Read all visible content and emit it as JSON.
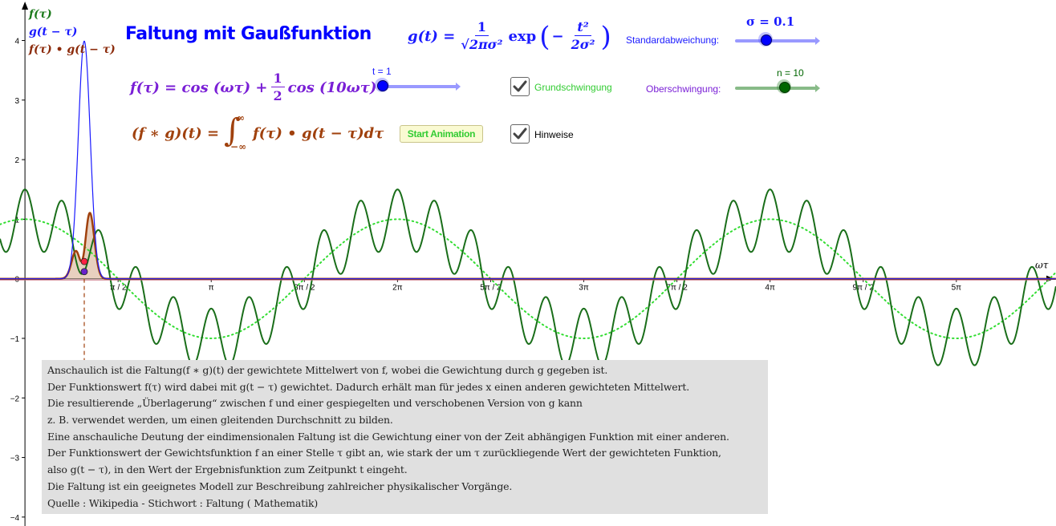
{
  "title": "Faltung mit Gaußfunktion",
  "legend": [
    {
      "label": "f(τ)",
      "color": "#1a7a1a"
    },
    {
      "label": "g(t − τ)",
      "color": "#1a1aff"
    },
    {
      "label": "f(τ) • g(t − τ)",
      "color": "#8b2a0a"
    }
  ],
  "formulas": {
    "g": {
      "lhs": "g(t) =",
      "frac_num": "1",
      "frac_den": "√2πσ²",
      "exp": "exp",
      "inner_sign": "−",
      "inner_num": "t²",
      "inner_den": "2σ²"
    },
    "f": {
      "lhs": "f(τ) = cos (ωτ) +",
      "frac_num": "1",
      "frac_den": "2",
      "rhs": "cos (10ωτ)"
    },
    "conv": {
      "lhs": "(f ∗ g)(t) =",
      "integral": "∫",
      "upper": "∞",
      "lower": "−∞",
      "rhs": "f(τ) • g(t − τ)dτ"
    }
  },
  "controls": {
    "sigma_slider": {
      "caption": "σ = 0.1",
      "label": "Standardabweichung:",
      "value": 0.1,
      "position_fraction": 0.37,
      "color": "#0000ff",
      "track_color": "#9999ff"
    },
    "t_slider": {
      "caption": "t = 1",
      "value": 1,
      "position_fraction": 0.0,
      "color": "#0000ff",
      "track_color": "#9999ff"
    },
    "n_slider": {
      "caption": "n = 10",
      "label": "Oberschwingung:",
      "value": 10,
      "position_fraction": 0.6,
      "color": "#006600",
      "track_color": "#88bb88"
    },
    "grundschwingung": {
      "label": "Grundschwingung",
      "checked": true,
      "color": "#33cc33"
    },
    "hinweise": {
      "label": "Hinweise",
      "checked": true,
      "color": "#000000"
    },
    "start_button": {
      "label": "Start Animation"
    }
  },
  "notes": [
    "Anschaulich ist die Faltung(f ∗ g)(t) der gewichtete Mittelwert von f, wobei die Gewichtung durch g gegeben ist.",
    "Der Funktionswert f(τ) wird dabei mit g(t − τ) gewichtet. Dadurch erhält man für jedes x einen anderen gewichteten Mittelwert.",
    "Die resultierende „Überlagerung“ zwischen f und einer gespiegelten und verschobenen Version von g kann",
    "z. B. verwendet werden, um einen gleitenden Durchschnitt zu bilden.",
    "Eine anschauliche Deutung der eindimensionalen Faltung ist die Gewichtung einer von der Zeit abhängigen Funktion mit einer anderen.",
    "Der Funktionswert der Gewichtsfunktion f an einer Stelle τ gibt an, wie stark der um τ zurückliegende Wert der gewichteten Funktion,",
    "also g(t − τ), in den Wert der Ergebnisfunktion zum Zeitpunkt t eingeht.",
    "Die Faltung ist ein geeignetes Modell zur Beschreibung zahlreicher physikalischer Vorgänge.",
    "Quelle :  Wikipedia - Stichwort :  Faltung ( Mathematik)"
  ],
  "chart_data": {
    "type": "line",
    "title": "Faltung mit Gaußfunktion",
    "xlabel": "ωτ",
    "ylabel": "",
    "xlim": [
      -0.134,
      5.535
    ],
    "xlim_units": "multiples of π",
    "ylim": [
      -4.15,
      4.68
    ],
    "x_ticks": [
      {
        "value_pi": 0.5,
        "label": "π / 2"
      },
      {
        "value_pi": 1,
        "label": "π"
      },
      {
        "value_pi": 1.5,
        "label": "3π / 2"
      },
      {
        "value_pi": 2,
        "label": "2π"
      },
      {
        "value_pi": 2.5,
        "label": "5π / 2"
      },
      {
        "value_pi": 3,
        "label": "3π"
      },
      {
        "value_pi": 3.5,
        "label": "7π / 2"
      },
      {
        "value_pi": 4,
        "label": "4π"
      },
      {
        "value_pi": 4.5,
        "label": "9π / 2"
      },
      {
        "value_pi": 5,
        "label": "5π"
      }
    ],
    "y_ticks": [
      {
        "value": -4,
        "label": "−4"
      },
      {
        "value": -3,
        "label": "−3"
      },
      {
        "value": -2,
        "label": "−2"
      },
      {
        "value": -1,
        "label": "−1"
      },
      {
        "value": 0,
        "label": "0"
      },
      {
        "value": 1,
        "label": "1"
      },
      {
        "value": 2,
        "label": "2"
      },
      {
        "value": 3,
        "label": "3"
      },
      {
        "value": 4,
        "label": "4"
      }
    ],
    "grid": false,
    "parameters": {
      "t": 1,
      "sigma": 0.1,
      "n": 10,
      "harmonic_amplitude": 0.5
    },
    "series": [
      {
        "name": "f(τ) = cos(τ) + 0.5·cos(10τ)",
        "style": "solid",
        "color": "#1a6e1a"
      },
      {
        "name": "Grundschwingung cos(τ)",
        "style": "dotted",
        "color": "#33dd33"
      },
      {
        "name": "g(t − τ) Gauß, σ = 0.1",
        "style": "solid",
        "color": "#1a1aff",
        "peak": 3.99
      },
      {
        "name": "f(τ) • g(t − τ)",
        "style": "solid-filled",
        "color": "#a0410d",
        "fill": "#e6cbb8",
        "peak_approx": 1.08
      }
    ],
    "points": [
      {
        "name": "product-point",
        "x": 1,
        "y": 0.29,
        "color": "#ff2244"
      },
      {
        "name": "f-point",
        "x": 1,
        "y": 0.12,
        "color": "#6a22cc"
      }
    ],
    "marker_line": {
      "x": 1,
      "style": "dashed",
      "color": "#a0410d"
    }
  }
}
